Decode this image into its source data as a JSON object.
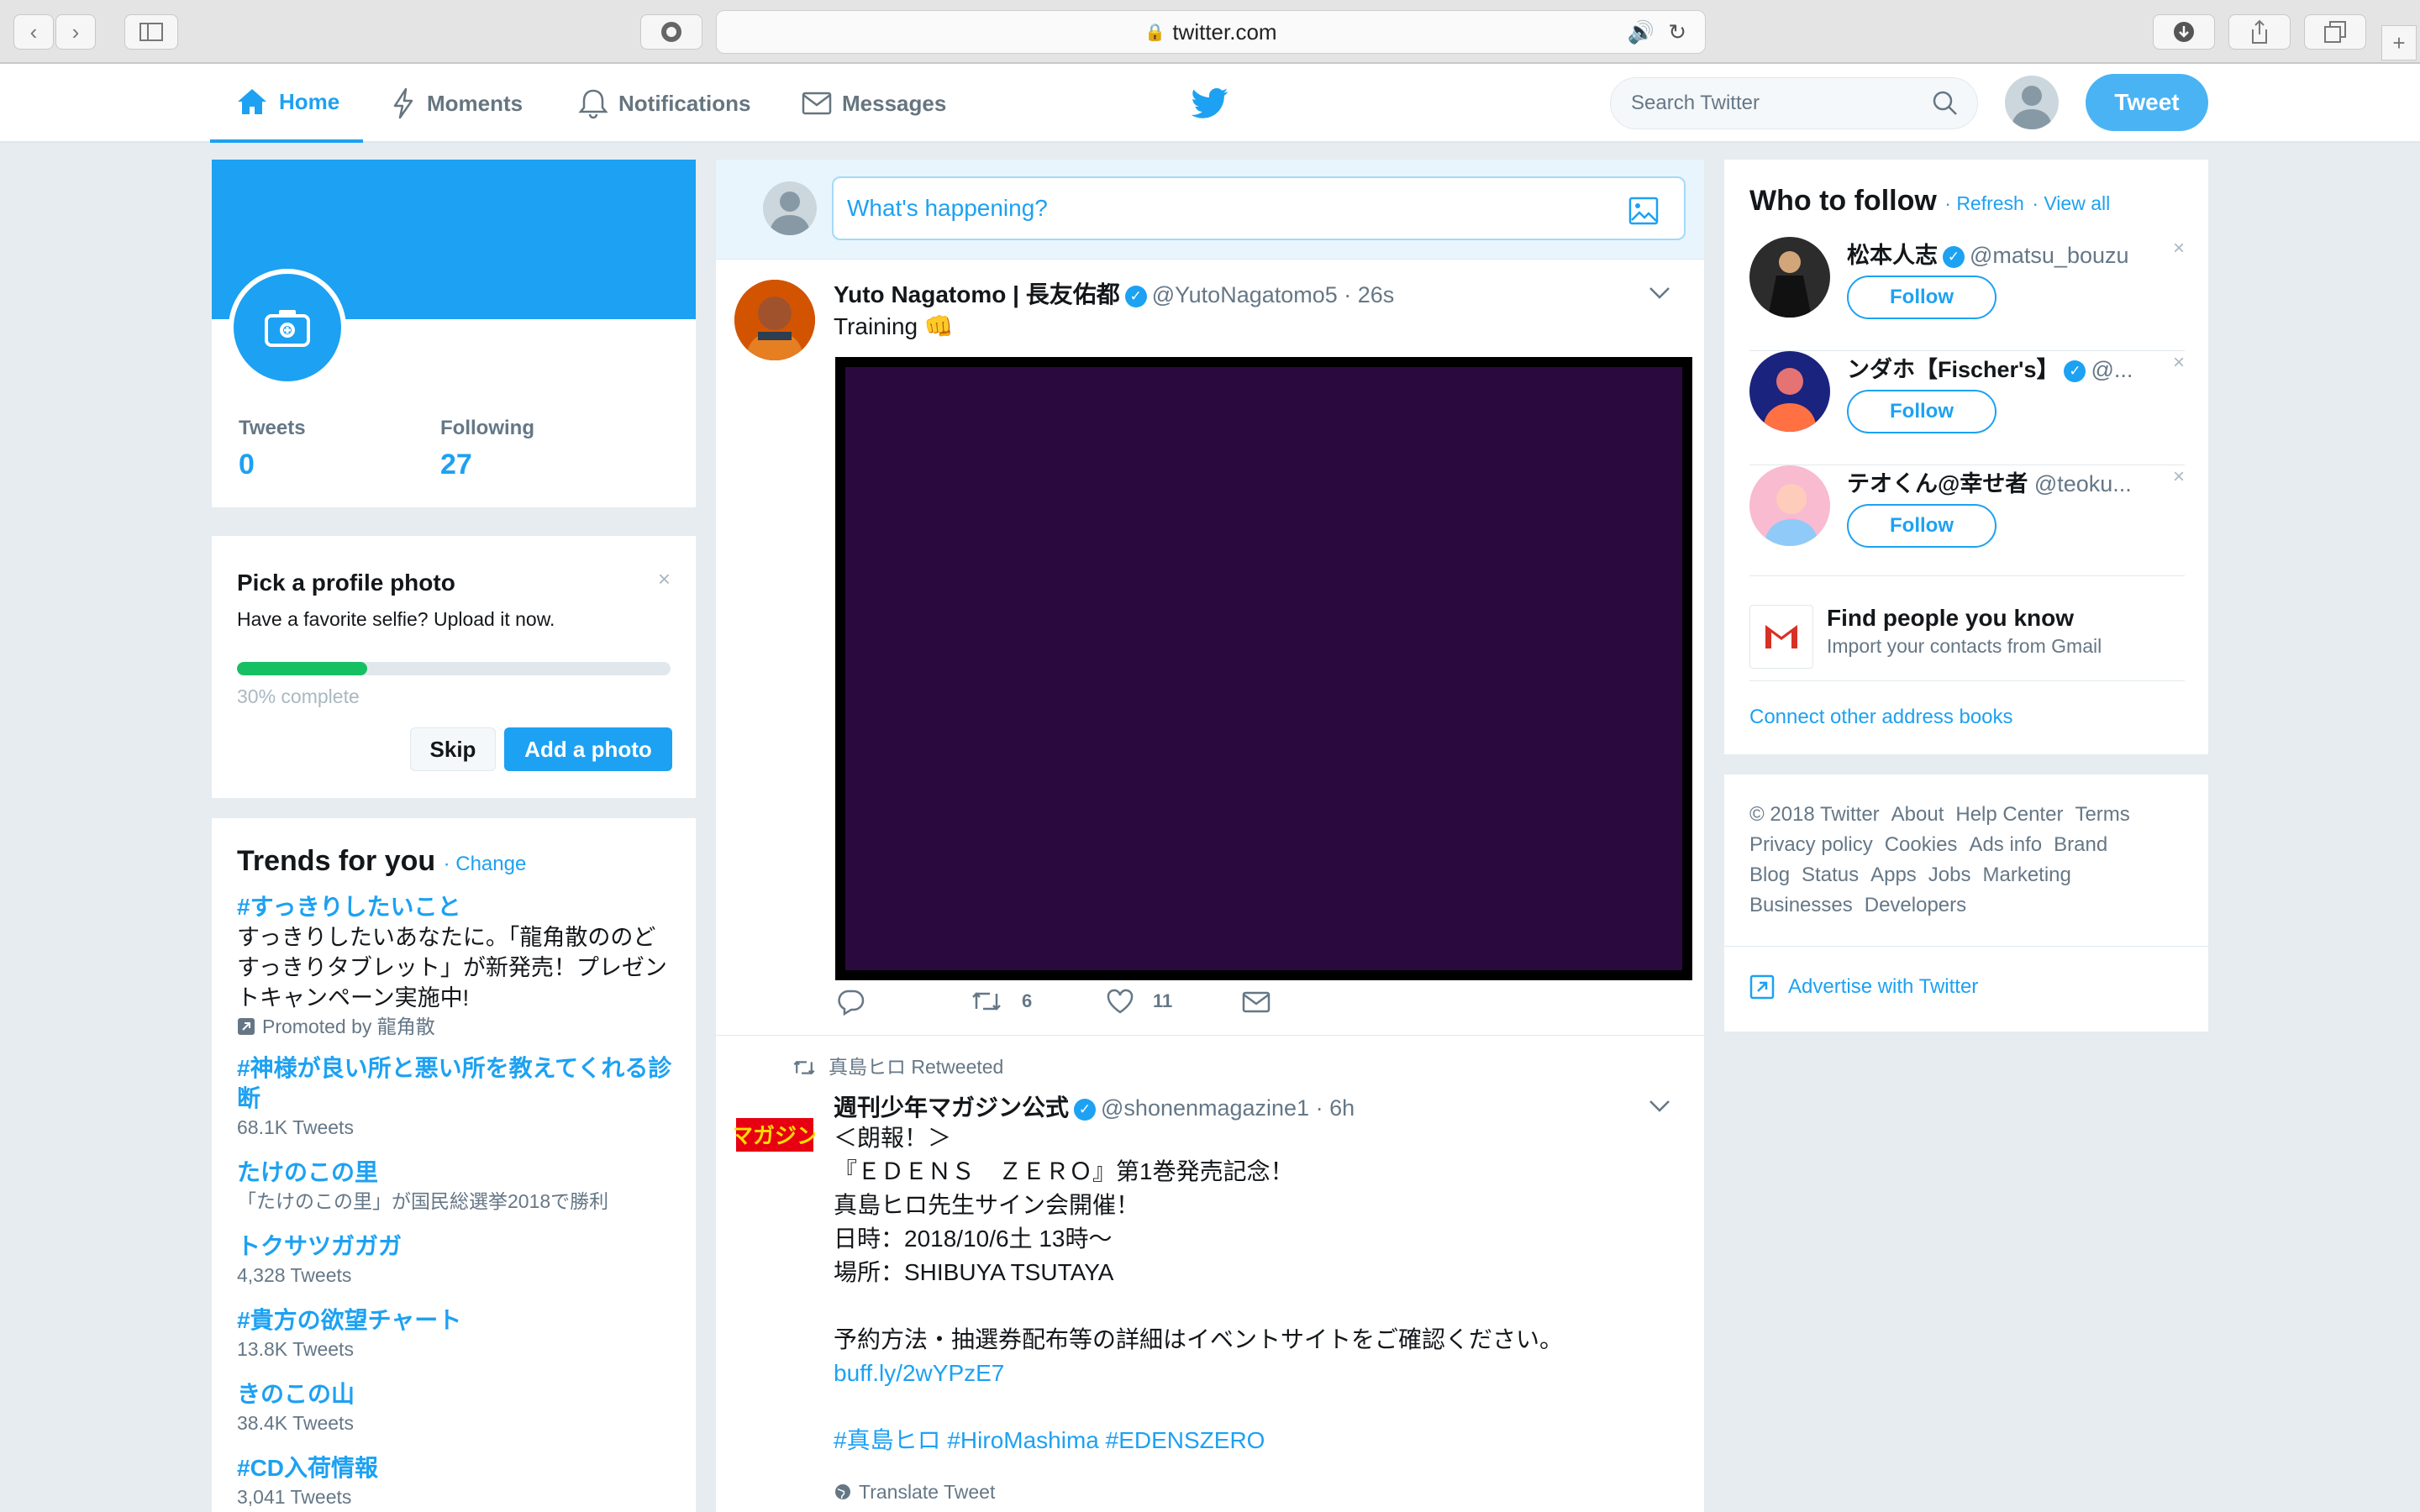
{
  "browser": {
    "url": "twitter.com"
  },
  "nav": {
    "home": "Home",
    "moments": "Moments",
    "notifications": "Notifications",
    "messages": "Messages",
    "search_placeholder": "Search Twitter",
    "tweet_button": "Tweet"
  },
  "profile": {
    "tweets_label": "Tweets",
    "tweets_count": "0",
    "following_label": "Following",
    "following_count": "27"
  },
  "profile_photo_prompt": {
    "title": "Pick a profile photo",
    "subtitle": "Have a favorite selfie? Upload it now.",
    "progress_fraction": 0.3,
    "progress_label": "30% complete",
    "skip": "Skip",
    "add": "Add a photo"
  },
  "trends": {
    "title": "Trends for you",
    "change": "· Change",
    "items": [
      {
        "name": "#すっきりしたいこと",
        "desc": "すっきりしたいあなたに。「龍角散ののどすっきりタブレット」が新発売！プレゼントキャンペーン実施中!",
        "promoted": "Promoted by 龍角散"
      },
      {
        "name": "#神様が良い所と悪い所を教えてくれる診断",
        "count": "68.1K Tweets"
      },
      {
        "name": "たけのこの里",
        "count": "「たけのこの里」が国民総選挙2018で勝利"
      },
      {
        "name": "トクサツガガガ",
        "count": "4,328 Tweets"
      },
      {
        "name": "#貴方の欲望チャート",
        "count": "13.8K Tweets"
      },
      {
        "name": "きのこの山",
        "count": "38.4K Tweets"
      },
      {
        "name": "#CD入荷情報",
        "count": "3,041 Tweets"
      }
    ]
  },
  "compose": {
    "placeholder": "What's happening?"
  },
  "tweets": [
    {
      "name": "Yuto Nagatomo | 長友佑都",
      "handle": "@YutoNagatomo5 · 26s",
      "text": "Training 👊",
      "retweets": "6",
      "likes": "11"
    },
    {
      "retweeted_by": "真島ヒロ Retweeted",
      "name": "週刊少年マガジン公式",
      "handle": "@shonenmagazine1 · 6h",
      "lines": [
        "＜朗報！＞",
        "『ＥＤＥＮＳ　ＺＥＲＯ』第1巻発売記念！",
        "真島ヒロ先生サイン会開催！",
        "日時：2018/10/6土 13時〜",
        "場所：SHIBUYA TSUTAYA",
        "予約方法・抽選券配布等の詳細はイベントサイトをご確認ください。"
      ],
      "link": "buff.ly/2wYPzE7",
      "hashtags": "#真島ヒロ #HiroMashima #EDENSZERO",
      "translate": "Translate Tweet"
    }
  ],
  "who_to_follow": {
    "title": "Who to follow",
    "refresh": "· Refresh",
    "view_all": "· View all",
    "follow_label": "Follow",
    "users": [
      {
        "name": "松本人志",
        "handle": "@matsu_bouzu"
      },
      {
        "name": "ンダホ【Fischer's】",
        "handle": "@..."
      },
      {
        "name": "テオくん@幸せ者",
        "handle": "@teoku..."
      }
    ],
    "find_title": "Find people you know",
    "find_sub": "Import your contacts from Gmail",
    "connect": "Connect other address books"
  },
  "footer": {
    "links": [
      "© 2018 Twitter",
      "About",
      "Help Center",
      "Terms",
      "Privacy policy",
      "Cookies",
      "Ads info",
      "Brand",
      "Blog",
      "Status",
      "Apps",
      "Jobs",
      "Marketing",
      "Businesses",
      "Developers"
    ],
    "advertise": "Advertise with Twitter"
  },
  "colors": {
    "brand": "#1da1f2",
    "progress": "#17bf63",
    "background": "#e6ecf0"
  }
}
